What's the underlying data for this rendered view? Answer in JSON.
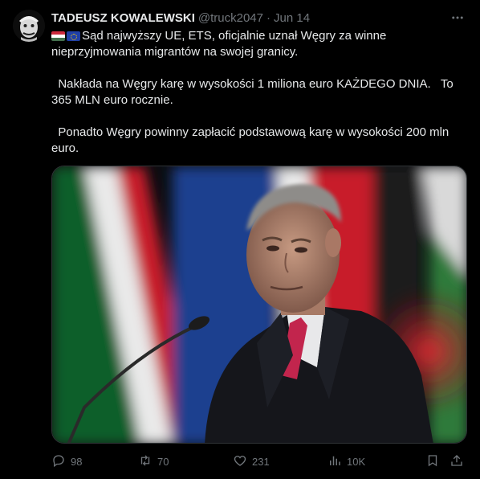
{
  "author": {
    "name": "TADEUSZ KOWALEWSKI",
    "handle": "@truck2047",
    "separator": "·",
    "date": "Jun 14"
  },
  "tweet": {
    "line1": "Sąd najwyższy UE, ETS, oficjalnie uznał Węgry za winne nieprzyjmowania migrantów na swojej granicy.",
    "line2": "  Nakłada na Węgry karę w wysokości 1 miliona euro KAŻDEGO DNIA.   To 365 MLN euro rocznie.",
    "line3": "  Ponadto Węgry powinny zapłacić podstawową karę w wysokości 200 mln euro."
  },
  "stats": {
    "replies": "98",
    "reposts": "70",
    "likes": "231",
    "views": "10K"
  },
  "icons": {
    "more": "more-icon",
    "reply": "reply-icon",
    "repost": "repost-icon",
    "like": "heart-icon",
    "views": "views-icon",
    "bookmark": "bookmark-icon",
    "share": "share-icon"
  },
  "colors": {
    "background": "#000000",
    "text": "#e7e9ea",
    "muted": "#71767b",
    "border": "#2f3336"
  }
}
